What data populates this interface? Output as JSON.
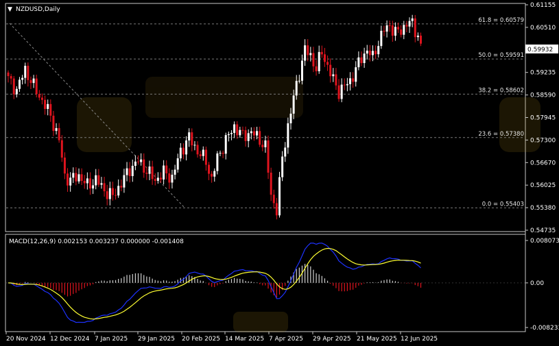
{
  "symbol_label": "NZDUSD,Daily",
  "macd_label": "MACD(12,26,9) 0.002153 0.003237 0.000000 -0.001408",
  "price_axis": {
    "ticks": [
      "0.61155",
      "0.60510",
      "0.59932",
      "0.59235",
      "0.58590",
      "0.57945",
      "0.57300",
      "0.56670",
      "0.56025",
      "0.55380",
      "0.54735"
    ],
    "current_price_label": "0.59932",
    "min": 0.54735,
    "max": 0.61155
  },
  "macd_axis": {
    "ticks": [
      "0.008073",
      "0.00",
      "-0.008233"
    ],
    "max": 0.008073,
    "min": -0.008233
  },
  "date_labels": [
    "20 Nov 2024",
    "12 Dec 2024",
    "7 Jan 2025",
    "29 Jan 2025",
    "20 Feb 2025",
    "14 Mar 2025",
    "7 Apr 2025",
    "29 Apr 2025",
    "21 May 2025",
    "12 Jun 2025"
  ],
  "fibonacci_levels": [
    {
      "label": "61.8 = 0.60579",
      "price": 0.60579
    },
    {
      "label": "50.0 = 0.59591",
      "price": 0.59591
    },
    {
      "label": "38.2 = 0.58602",
      "price": 0.58602
    },
    {
      "label": "23.6 = 0.57380",
      "price": 0.5738
    },
    {
      "label": "0.0 = 0.55403",
      "price": 0.55403
    }
  ],
  "colors": {
    "background": "#000000",
    "bull_candle": "#ffffff",
    "bear_candle": "#e0141e",
    "grid_dotted": "#7a7a7a",
    "macd_line": "#1e32ff",
    "signal_line": "#ffff32",
    "hist_positive": "#d2d2d2",
    "hist_negative": "#e0141e",
    "price_tag": "#ffffff"
  },
  "chart_data": [
    {
      "type": "candlestick",
      "title": "NZDUSD,Daily",
      "ylim": [
        0.54735,
        0.61155
      ],
      "x_tick_labels": [
        "20 Nov 2024",
        "12 Dec 2024",
        "7 Jan 2025",
        "29 Jan 2025",
        "20 Feb 2025",
        "14 Mar 2025",
        "7 Apr 2025",
        "29 Apr 2025",
        "21 May 2025",
        "12 Jun 2025"
      ],
      "close_path": [
        [
          0,
          0.5902
        ],
        [
          3,
          0.5872
        ],
        [
          6,
          0.593
        ],
        [
          9,
          0.5882
        ],
        [
          12,
          0.5842
        ],
        [
          15,
          0.58
        ],
        [
          18,
          0.573
        ],
        [
          20,
          0.563
        ],
        [
          22,
          0.5618
        ],
        [
          25,
          0.5632
        ],
        [
          28,
          0.5602
        ],
        [
          31,
          0.562
        ],
        [
          34,
          0.559
        ],
        [
          37,
          0.5572
        ],
        [
          40,
          0.561
        ],
        [
          43,
          0.565
        ],
        [
          46,
          0.5672
        ],
        [
          49,
          0.5645
        ],
        [
          52,
          0.5618
        ],
        [
          55,
          0.564
        ],
        [
          58,
          0.5625
        ],
        [
          61,
          0.57
        ],
        [
          64,
          0.5738
        ],
        [
          67,
          0.57
        ],
        [
          70,
          0.5672
        ],
        [
          72,
          0.562
        ],
        [
          74,
          0.568
        ],
        [
          77,
          0.573
        ],
        [
          80,
          0.577
        ],
        [
          83,
          0.5742
        ],
        [
          86,
          0.5754
        ],
        [
          89,
          0.5732
        ],
        [
          91,
          0.5712
        ],
        [
          93,
          0.5575
        ],
        [
          95,
          0.5535
        ],
        [
          97,
          0.568
        ],
        [
          99,
          0.5772
        ],
        [
          101,
          0.585
        ],
        [
          103,
          0.592
        ],
        [
          105,
          0.5985
        ],
        [
          107,
          0.5968
        ],
        [
          109,
          0.5932
        ],
        [
          111,
          0.598
        ],
        [
          113,
          0.5938
        ],
        [
          115,
          0.59
        ],
        [
          117,
          0.5868
        ],
        [
          119,
          0.5882
        ],
        [
          121,
          0.5898
        ],
        [
          123,
          0.593
        ],
        [
          125,
          0.5962
        ],
        [
          127,
          0.5985
        ],
        [
          129,
          0.5962
        ],
        [
          131,
          0.6008
        ],
        [
          133,
          0.604
        ],
        [
          135,
          0.6055
        ],
        [
          137,
          0.6032
        ],
        [
          139,
          0.604
        ],
        [
          141,
          0.606
        ],
        [
          143,
          0.6058
        ],
        [
          145,
          0.6025
        ],
        [
          146,
          0.5993
        ]
      ]
    },
    {
      "type": "line",
      "title": "MACD(12,26,9) 0.002153 0.003237 0.000000 -0.001408",
      "ylim": [
        -0.008233,
        0.008073
      ],
      "series": [
        {
          "name": "MACD",
          "latest": 0.002153
        },
        {
          "name": "Signal",
          "latest": 0.003237
        },
        {
          "name": "Histogram",
          "latest": -0.001408
        }
      ],
      "zero_line": 0.0
    }
  ]
}
